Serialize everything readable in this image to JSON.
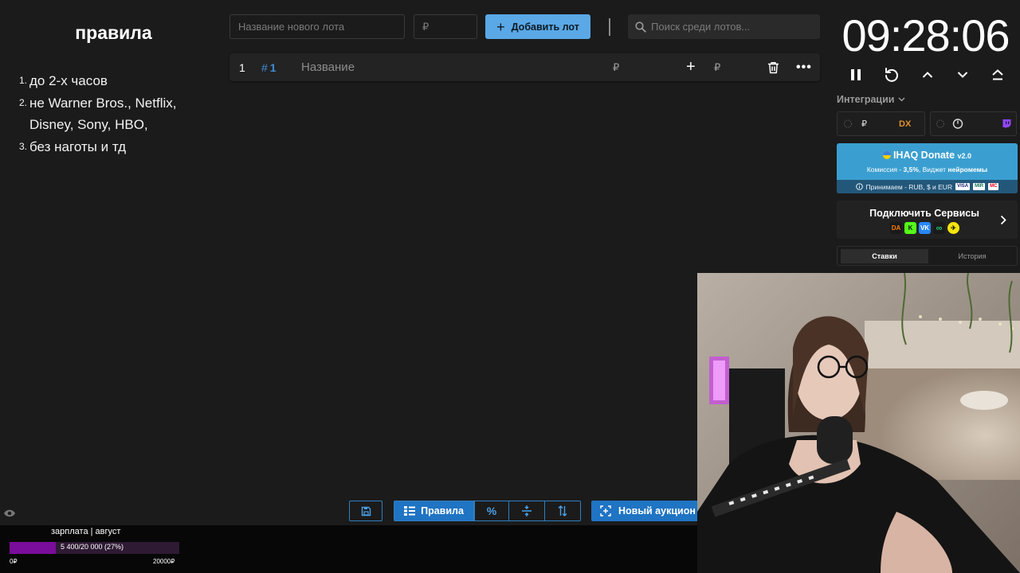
{
  "rules": {
    "title": "правила",
    "items": [
      {
        "num": "1.",
        "text": "до 2-х часов"
      },
      {
        "num": "2.",
        "text": "не Warner Bros., Netflix, Disney, Sony, HBO,"
      },
      {
        "num": "3.",
        "text": "без наготы и тд"
      }
    ]
  },
  "topbar": {
    "lot_name_placeholder": "Название нового лота",
    "amount_placeholder": "₽",
    "add_lot_label": "Добавить лот",
    "search_placeholder": "Поиск среди лотов..."
  },
  "lot": {
    "index": "1",
    "tag": "1",
    "title_placeholder": "Название",
    "currency": "₽",
    "add_currency": "₽"
  },
  "toolbar": {
    "rules_label": "Правила",
    "percent_label": "%",
    "new_auction_label": "Новый аукцион"
  },
  "goal": {
    "title": "зарплата | август",
    "progress_text": "5 400/20 000 (27%)",
    "progress": 0.27,
    "min_label": "0₽",
    "max_label": "20000₽"
  },
  "timer": {
    "time": "09:28:06"
  },
  "integrations": {
    "label": "Интеграции",
    "card1_currency": "₽",
    "card1_logo": "DX"
  },
  "donate": {
    "title": "IHAQ Donate",
    "version": "v2.0",
    "commission_prefix": "Комиссия - ",
    "commission_value": "3,5%",
    "widget_text": ", Виджет ",
    "widget_value": "нейромемы",
    "accepts": "Принимаем - RUB, $ и EUR",
    "badges": [
      "VISA",
      "MIR",
      "MC"
    ]
  },
  "connect": {
    "title": "Подключить Сервисы",
    "icons": [
      "DA",
      "K",
      "VK",
      "∞",
      "✈"
    ]
  },
  "history_tabs": {
    "bets": "Ставки",
    "history": "История"
  },
  "colors": {
    "accent": "#5aa8e6",
    "primary_blue": "#1f74c3",
    "goal_fill": "#7a0d9b",
    "donate_bg": "#3a9fd0"
  }
}
